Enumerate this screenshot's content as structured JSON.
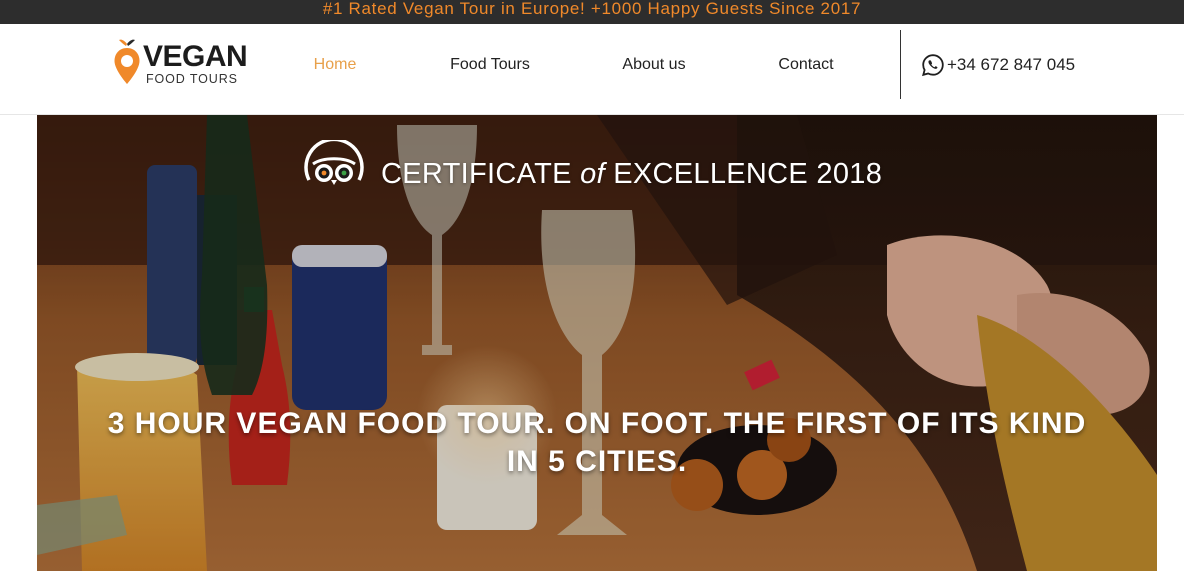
{
  "announcement": {
    "text": "#1 Rated Vegan Tour in Europe! +1000 Happy Guests Since 2017"
  },
  "logo": {
    "brand": "VEGAN",
    "sub": "FOOD TOURS",
    "icon": "map-pin-leaf-icon"
  },
  "nav": {
    "items": [
      {
        "label": "Home",
        "active": true
      },
      {
        "label": "Food Tours",
        "active": false
      },
      {
        "label": "About us",
        "active": false
      },
      {
        "label": "Contact",
        "active": false
      }
    ]
  },
  "contact": {
    "phone": "+34 672 847 045",
    "icon": "whatsapp-icon"
  },
  "hero": {
    "certificate": {
      "prefix": "CERTIFICATE",
      "connector": "of",
      "suffix": "EXCELLENCE 2018",
      "icon": "tripadvisor-owl-icon"
    },
    "headline": "3 HOUR VEGAN FOOD TOUR. ON FOOT. THE FIRST OF ITS KIND IN 5 CITIES."
  },
  "colors": {
    "accent": "#f0892a",
    "nav_active": "#e8a04a",
    "topbar": "#2d2d2d"
  }
}
